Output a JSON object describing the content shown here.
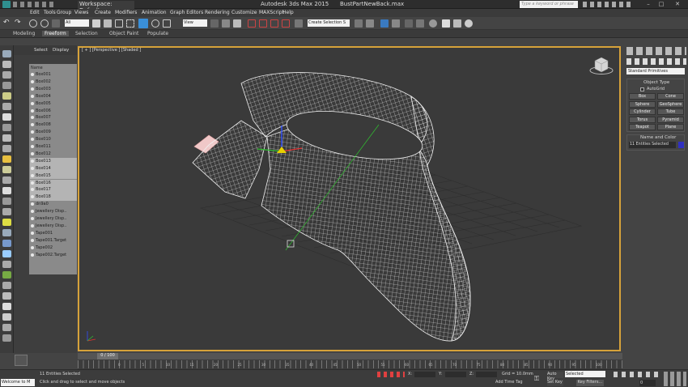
{
  "window": {
    "workspace": "Workspace: Default",
    "title": "Autodesk 3ds Max  2015",
    "filename": "BustPartNewBack.max",
    "search_placeholder": "Type a keyword or phrase"
  },
  "menu": [
    "Edit",
    "Tools",
    "Group",
    "Views",
    "Create",
    "Modifiers",
    "Animation",
    "Graph Editors",
    "Rendering",
    "Customize",
    "MAXScript",
    "Help"
  ],
  "toolbar": {
    "filter": "All",
    "view": "View",
    "selection_set": "Create Selection S"
  },
  "ribbon": [
    "Modeling",
    "Freeform",
    "Selection",
    "Object Paint",
    "Populate"
  ],
  "ribbon_active": 1,
  "explorer": {
    "tabs": [
      "Select",
      "Display"
    ],
    "column": "Name",
    "items": [
      "Box001",
      "Box002",
      "Box003",
      "Box004",
      "Box005",
      "Box006",
      "Box007",
      "Box008",
      "Box009",
      "Box010",
      "Box011",
      "Box012",
      "Box013",
      "Box014",
      "Box015",
      "Box016",
      "Box017",
      "Box018",
      "dn9a0",
      "Jewellery Disp..",
      "Jewellery Disp..",
      "Jewellery Disp..",
      "Tape001",
      "Tape001.Target",
      "Tape002",
      "Tape002.Target"
    ],
    "selected_from": 12,
    "selected_to": 17
  },
  "viewport": {
    "label": "[ + ] [Perspective ] [Shaded ]"
  },
  "command_panel": {
    "dropdown": "Standard Primitives",
    "object_type_title": "Object Type",
    "autogrid": "AutoGrid",
    "buttons": [
      "Box",
      "Cone",
      "Sphere",
      "GeoSphere",
      "Cylinder",
      "Tube",
      "Torus",
      "Pyramid",
      "Teapot",
      "Plane"
    ],
    "name_color_title": "Name and Color",
    "name_value": "11 Entities Selected",
    "color": "#3030c0"
  },
  "timeline": {
    "frame": "0 / 100",
    "ticks": [
      "0",
      "5",
      "10",
      "15",
      "20",
      "25",
      "30",
      "35",
      "40",
      "45",
      "50",
      "55",
      "60",
      "65",
      "70",
      "75",
      "80",
      "85",
      "90",
      "95",
      "100"
    ]
  },
  "status": {
    "maxscript": "Welcome to M",
    "selection": "11 Entities Selected",
    "prompt": "Click and drag to select and move objects",
    "x_label": "X:",
    "y_label": "Y:",
    "z_label": "Z:",
    "grid": "Grid = 10.0mm",
    "add_time_tag": "Add Time Tag",
    "auto_key": "Auto Key",
    "set_key": "Set Key",
    "key_mode": "Selected",
    "key_filters": "Key Filters...",
    "frame_value": "0"
  }
}
